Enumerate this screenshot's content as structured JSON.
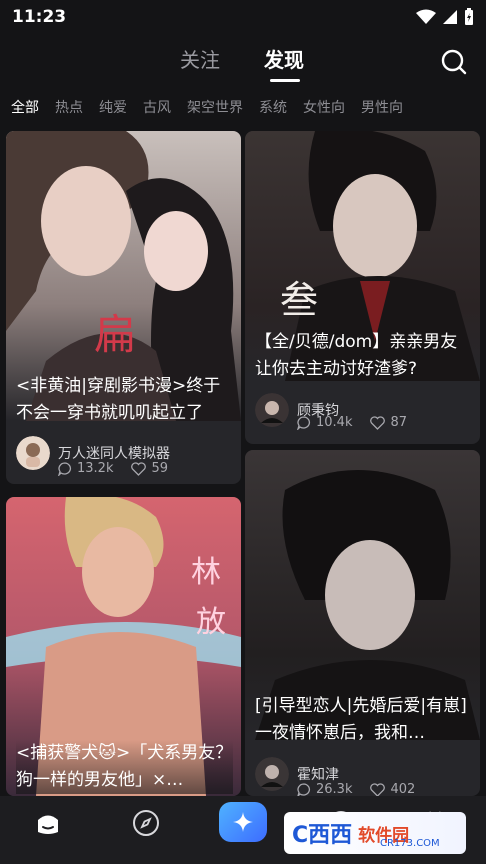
{
  "status_bar": {
    "time": "11:23"
  },
  "top_tabs": {
    "follow": "关注",
    "discover": "发现"
  },
  "categories": [
    "全部",
    "热点",
    "纯爱",
    "古风",
    "架空世界",
    "系统",
    "女性向",
    "男性向"
  ],
  "cards": [
    {
      "title": "<非黄油|穿剧影书漫>终于不会一穿书就叽叽起立了",
      "author": "万人迷同人模拟器",
      "comments": "13.2k",
      "likes": "59",
      "art_text": "扁"
    },
    {
      "title": "【全/贝德/dom】亲亲男友让你去主动讨好渣爹?",
      "author": "顾秉钧",
      "comments": "10.4k",
      "likes": "87",
      "art_text": "叁"
    },
    {
      "title": "<捕获警犬🐱>「犬系男友？狗一样的男友他」×…",
      "author": "",
      "comments": "",
      "likes": "",
      "art_text_1": "林",
      "art_text_2": "放"
    },
    {
      "title": "[引导型恋人|先婚后爱|有崽]一夜情怀崽后，我和…",
      "author": "霍知津",
      "comments": "26.3k",
      "likes": "402"
    }
  ],
  "watermark": {
    "logo": "C西西",
    "name": "软件园",
    "url": "CR173.COM"
  },
  "colors": {
    "background": "#141416",
    "accent": "#3d6cff",
    "card": "#26262a"
  }
}
